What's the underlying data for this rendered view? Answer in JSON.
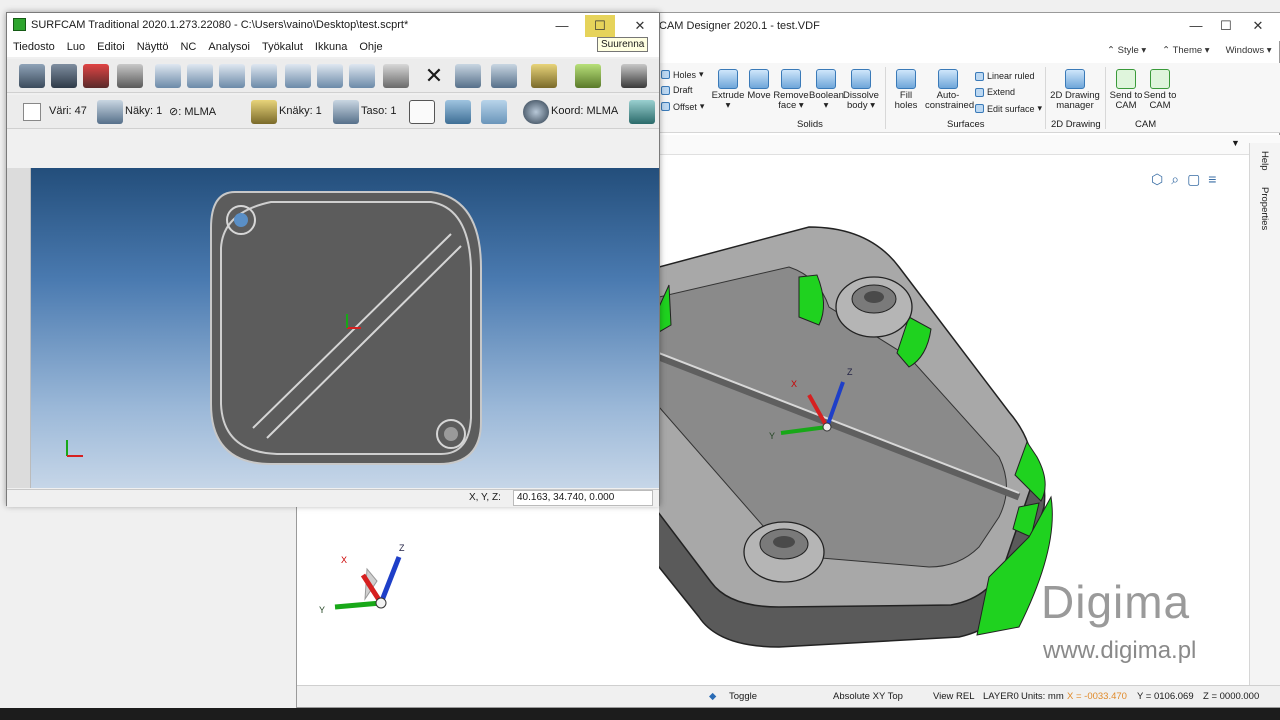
{
  "cad_window": {
    "title": "CAM Designer 2020.1 - test.VDF",
    "controls": {
      "minimize": "—",
      "maximize": "☐",
      "close": "✕"
    },
    "top_right": [
      "Style",
      "Theme",
      "Windows"
    ],
    "ribbon": {
      "small_items_left": [
        "Holes",
        "Draft",
        "Offset"
      ],
      "solids": [
        "Extrude",
        "Move",
        "Remove face",
        "Boolean",
        "Dissolve body"
      ],
      "surfaces": [
        "Fill holes",
        "Auto-constrained"
      ],
      "surfaces_small": [
        "Linear ruled",
        "Extend",
        "Edit surface"
      ],
      "drawing": [
        "2D Drawing manager"
      ],
      "cam": [
        "Send to CAM",
        "Send to CAM"
      ],
      "groups": [
        "Solids",
        "Surfaces",
        "2D Drawing",
        "CAM"
      ]
    },
    "right_panel": [
      "Help",
      "Properties"
    ],
    "status": {
      "toggle": "Toggle",
      "absolute": "Absolute XY Top",
      "view": "View REL",
      "layer": "LAYER0",
      "units": "Units: mm",
      "x": "X = -0033.470",
      "y": "Y = 0106.069",
      "z": "Z = 0000.000"
    },
    "axis_labels": {
      "x": "X",
      "y": "Y",
      "z": "Z"
    },
    "watermark": {
      "logo": "Digima",
      "url": "www.digima.pl"
    }
  },
  "surfcam_window": {
    "title": "SURFCAM Traditional 2020.1.273.22080 - C:\\Users\\vaino\\Desktop\\test.scprt*",
    "controls": {
      "minimize": "—",
      "maximize": "☐",
      "close": "✕"
    },
    "tooltip": "Suurenna",
    "menu": [
      "Tiedosto",
      "Luo",
      "Editoi",
      "Näyttö",
      "NC",
      "Analysoi",
      "Työkalut",
      "Ikkuna",
      "Ohje"
    ],
    "toolbar2": {
      "color": "Väri: 47",
      "visibility": "Näky: 1",
      "mlma1": ": MLMA",
      "sight": "Knäky: 1",
      "plane": "Taso: 1",
      "coord": "Koord: MLMA"
    },
    "status": {
      "label": "X, Y, Z:",
      "value": "40.163, 34.740, 0.000"
    }
  },
  "colors": {
    "accent_green": "#1fd21f",
    "viewport_top": "#234e7b",
    "viewport_bottom": "#c6d6e8",
    "part_grey": "#6a6a6a"
  }
}
